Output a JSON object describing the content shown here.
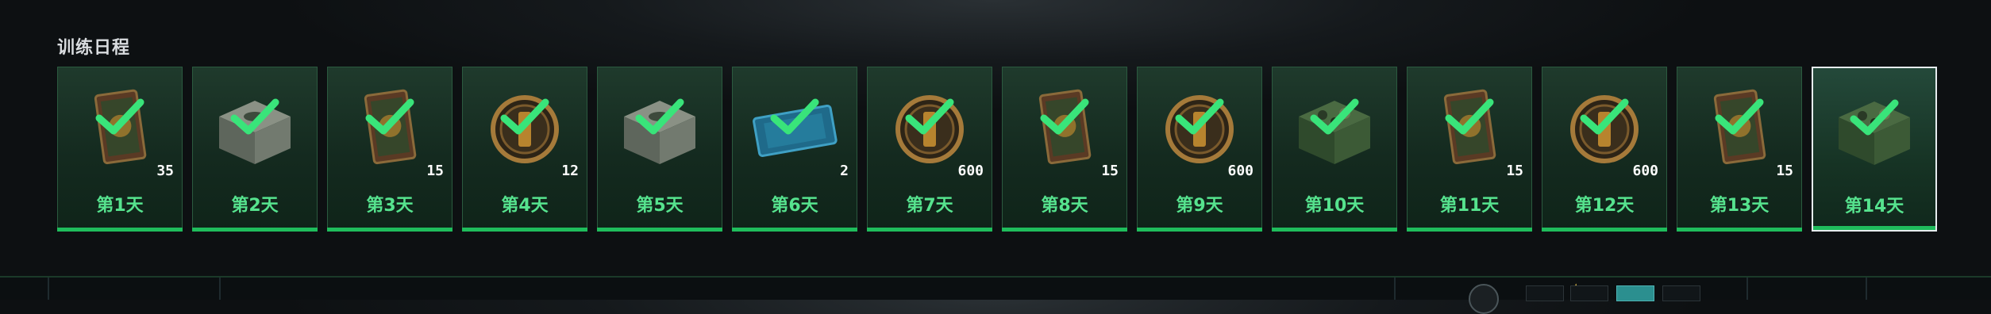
{
  "section": {
    "title": "训练日程"
  },
  "icons": {
    "completed": "checkmark-icon",
    "reward_types": [
      "bundle-card",
      "supply-crate",
      "medal-token",
      "ticket",
      "camo-crate"
    ]
  },
  "colors": {
    "completed_text": "#56e38e",
    "completed_bar": "#1fbd5c",
    "check": "#39e47a",
    "selected_border": "#e6ecef"
  },
  "days": [
    {
      "label": "第1天",
      "quantity": "35",
      "reward": "bundle-card",
      "claimed": true,
      "selected": false
    },
    {
      "label": "第2天",
      "quantity": "",
      "reward": "supply-crate",
      "claimed": true,
      "selected": false
    },
    {
      "label": "第3天",
      "quantity": "15",
      "reward": "bundle-card",
      "claimed": true,
      "selected": false
    },
    {
      "label": "第4天",
      "quantity": "12",
      "reward": "medal-token",
      "claimed": true,
      "selected": false
    },
    {
      "label": "第5天",
      "quantity": "",
      "reward": "supply-crate",
      "claimed": true,
      "selected": false
    },
    {
      "label": "第6天",
      "quantity": "2",
      "reward": "ticket",
      "claimed": true,
      "selected": false
    },
    {
      "label": "第7天",
      "quantity": "600",
      "reward": "medal-token",
      "claimed": true,
      "selected": false
    },
    {
      "label": "第8天",
      "quantity": "15",
      "reward": "bundle-card",
      "claimed": true,
      "selected": false
    },
    {
      "label": "第9天",
      "quantity": "600",
      "reward": "medal-token",
      "claimed": true,
      "selected": false
    },
    {
      "label": "第10天",
      "quantity": "",
      "reward": "camo-crate",
      "claimed": true,
      "selected": false
    },
    {
      "label": "第11天",
      "quantity": "15",
      "reward": "bundle-card",
      "claimed": true,
      "selected": false
    },
    {
      "label": "第12天",
      "quantity": "600",
      "reward": "medal-token",
      "claimed": true,
      "selected": false
    },
    {
      "label": "第13天",
      "quantity": "15",
      "reward": "bundle-card",
      "claimed": true,
      "selected": false
    },
    {
      "label": "第14天",
      "quantity": "",
      "reward": "camo-crate",
      "claimed": true,
      "selected": true
    }
  ]
}
